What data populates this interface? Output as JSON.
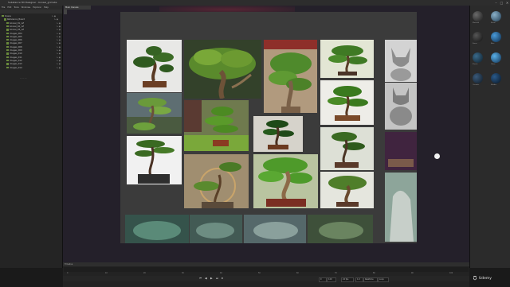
{
  "window": {
    "title": "Substance 3D Designer - bonsai_grid.sbs",
    "controls": [
      "–",
      "□",
      "✕"
    ]
  },
  "menu": [
    "File",
    "Edit",
    "Tools",
    "Windows",
    "Explorer",
    "Help"
  ],
  "outliner": {
    "items": [
      {
        "label": "Scene",
        "indent": 0
      },
      {
        "label": "Reference_Board",
        "indent": 1
      },
      {
        "label": "bonsai_01_ref",
        "indent": 2
      },
      {
        "label": "bonsai_02_ref",
        "indent": 2
      },
      {
        "label": "bonsai_03_ref",
        "indent": 2
      },
      {
        "label": "images_004",
        "indent": 2
      },
      {
        "label": "images_005",
        "indent": 2
      },
      {
        "label": "images_006",
        "indent": 2
      },
      {
        "label": "images_007",
        "indent": 2
      },
      {
        "label": "images_008",
        "indent": 2
      },
      {
        "label": "images_009",
        "indent": 2
      },
      {
        "label": "images_010",
        "indent": 2
      },
      {
        "label": "images_011",
        "indent": 2
      },
      {
        "label": "images_012",
        "indent": 2
      },
      {
        "label": "images_013",
        "indent": 2
      },
      {
        "label": "images_014",
        "indent": 2
      }
    ],
    "vis_label": "↳ ◉",
    "status": "— — —"
  },
  "viewport": {
    "tab_label": "Main Canvas"
  },
  "right_panel": {
    "swatch_labels": [
      "Material",
      "Metal",
      "Stone",
      "Blue",
      "Plastic",
      "Glass",
      "Ceramic",
      "Rubber"
    ]
  },
  "timeline": {
    "header": "Timeline",
    "ticks": [
      "0",
      "10",
      "20",
      "30",
      "40",
      "50",
      "60",
      "70",
      "80",
      "90",
      "100"
    ],
    "controls": [
      "⏮",
      "◀",
      "▶",
      "⏭",
      "⏺"
    ],
    "fields": [
      "0",
      "120",
      "24 fps",
      "1.0",
      "Realtime",
      "Loop"
    ]
  },
  "watermark": "Udemy",
  "colors": {
    "accent_green": "#6a8b3c",
    "canvas_bg": "#3b3b3b",
    "viewport_bg": "#24202a"
  }
}
